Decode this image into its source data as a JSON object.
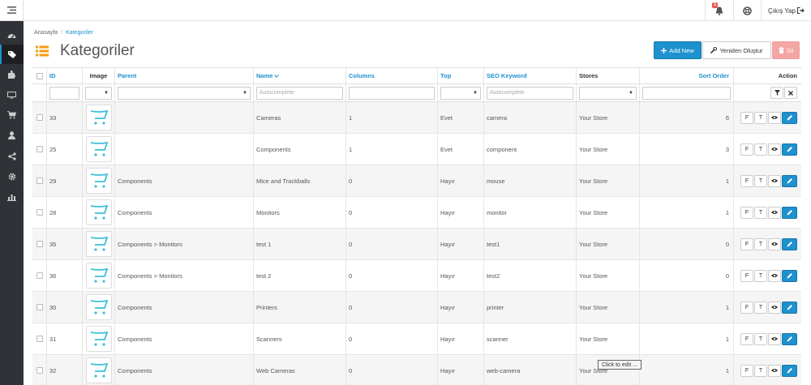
{
  "header": {
    "notification_count": "1",
    "logout_label": "Çıkış Yap"
  },
  "breadcrumb": [
    {
      "label": "Anasayfa"
    },
    {
      "label": "Kategoriler"
    }
  ],
  "breadcrumb_separator": "/",
  "page_title": "Kategoriler",
  "toolbar": {
    "add_label": "Add New",
    "rebuild_label": "Yeniden Oluştur",
    "delete_label": "Sil"
  },
  "columns": {
    "id": "ID",
    "image": "Image",
    "parent": "Parent",
    "name": "Name",
    "columns": "Columns",
    "top": "Top",
    "seo": "SEO Keyword",
    "stores": "Stores",
    "sort": "Sort Order",
    "action": "Action"
  },
  "filters": {
    "name_placeholder": "Autocomplete",
    "seo_placeholder": "Autocomplete"
  },
  "action_labels": {
    "f": "F",
    "t": "T"
  },
  "rows": [
    {
      "id": "33",
      "parent": "",
      "name": "Cameras",
      "columns": "1",
      "top": "Evet",
      "seo": "camera",
      "stores": "Your Store",
      "sort": "6"
    },
    {
      "id": "25",
      "parent": "",
      "name": "Components",
      "columns": "1",
      "top": "Evet",
      "seo": "component",
      "stores": "Your Store",
      "sort": "3"
    },
    {
      "id": "29",
      "parent": "Components",
      "name": "Mice and Trackballs",
      "columns": "0",
      "top": "Hayır",
      "seo": "mouse",
      "stores": "Your Store",
      "sort": "1"
    },
    {
      "id": "28",
      "parent": "Components",
      "name": "Monitors",
      "columns": "0",
      "top": "Hayır",
      "seo": "monitor",
      "stores": "Your Store",
      "sort": "1"
    },
    {
      "id": "35",
      "parent": "Components > Monitors",
      "name": "test 1",
      "columns": "0",
      "top": "Hayır",
      "seo": "test1",
      "stores": "Your Store",
      "sort": "0"
    },
    {
      "id": "36",
      "parent": "Components > Monitors",
      "name": "test 2",
      "columns": "0",
      "top": "Hayır",
      "seo": "test2",
      "stores": "Your Store",
      "sort": "0"
    },
    {
      "id": "30",
      "parent": "Components",
      "name": "Printers",
      "columns": "0",
      "top": "Hayır",
      "seo": "printer",
      "stores": "Your Store",
      "sort": "1"
    },
    {
      "id": "31",
      "parent": "Components",
      "name": "Scanners",
      "columns": "0",
      "top": "Hayır",
      "seo": "scanner",
      "stores": "Your Store",
      "sort": "1"
    },
    {
      "id": "32",
      "parent": "Components",
      "name": "Web Cameras",
      "columns": "0",
      "top": "Hayır",
      "seo": "web-camera",
      "stores": "Your Store",
      "sort": "1"
    }
  ],
  "tooltip": "Click to edit ...",
  "colors": {
    "accent": "#1e91cf",
    "sidebar": "#2f3337",
    "danger": "#f3a6a4",
    "title_icon": "#f39c12",
    "cart_icon": "#3dbfd9"
  }
}
